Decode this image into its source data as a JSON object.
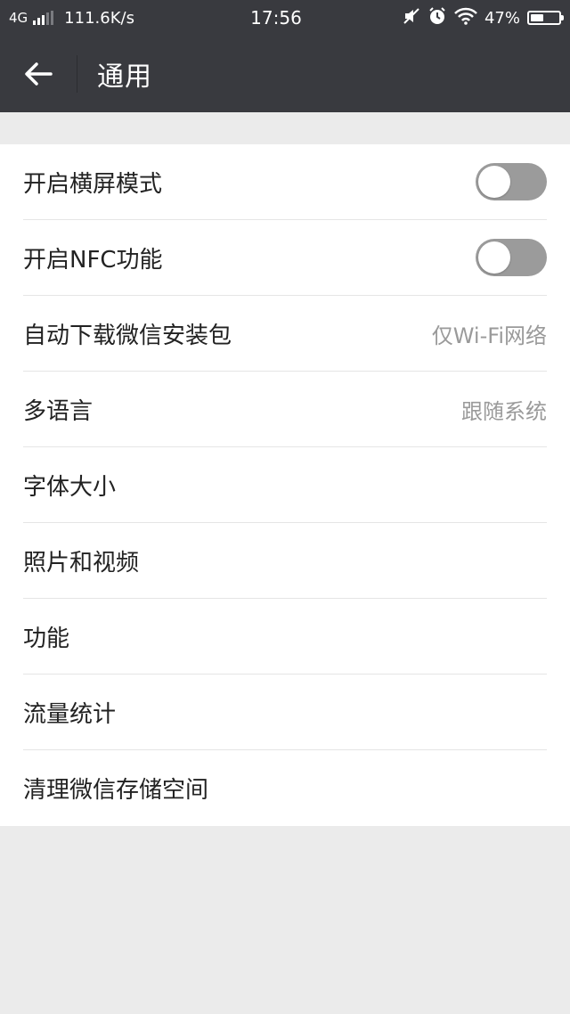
{
  "status_bar": {
    "network": "4G",
    "speed": "111.6K/s",
    "time": "17:56",
    "battery_percent": "47%",
    "battery_level": 0.47,
    "icons": [
      "signal-icon",
      "mute-icon",
      "alarm-icon",
      "wifi-icon",
      "battery-icon"
    ]
  },
  "app_bar": {
    "title": "通用",
    "back_icon": "arrow-left-icon"
  },
  "settings": {
    "items": [
      {
        "label": "开启横屏模式",
        "toggle": false
      },
      {
        "label": "开启NFC功能",
        "toggle": false
      },
      {
        "label": "自动下载微信安装包",
        "value": "仅Wi-Fi网络"
      },
      {
        "label": "多语言",
        "value": "跟随系统"
      },
      {
        "label": "字体大小"
      },
      {
        "label": "照片和视频"
      },
      {
        "label": "功能"
      },
      {
        "label": "流量统计"
      },
      {
        "label": "清理微信存储空间"
      }
    ]
  },
  "colors": {
    "header_bg": "#393a3f",
    "page_bg": "#ebebeb",
    "toggle_off": "#9b9b9b"
  }
}
